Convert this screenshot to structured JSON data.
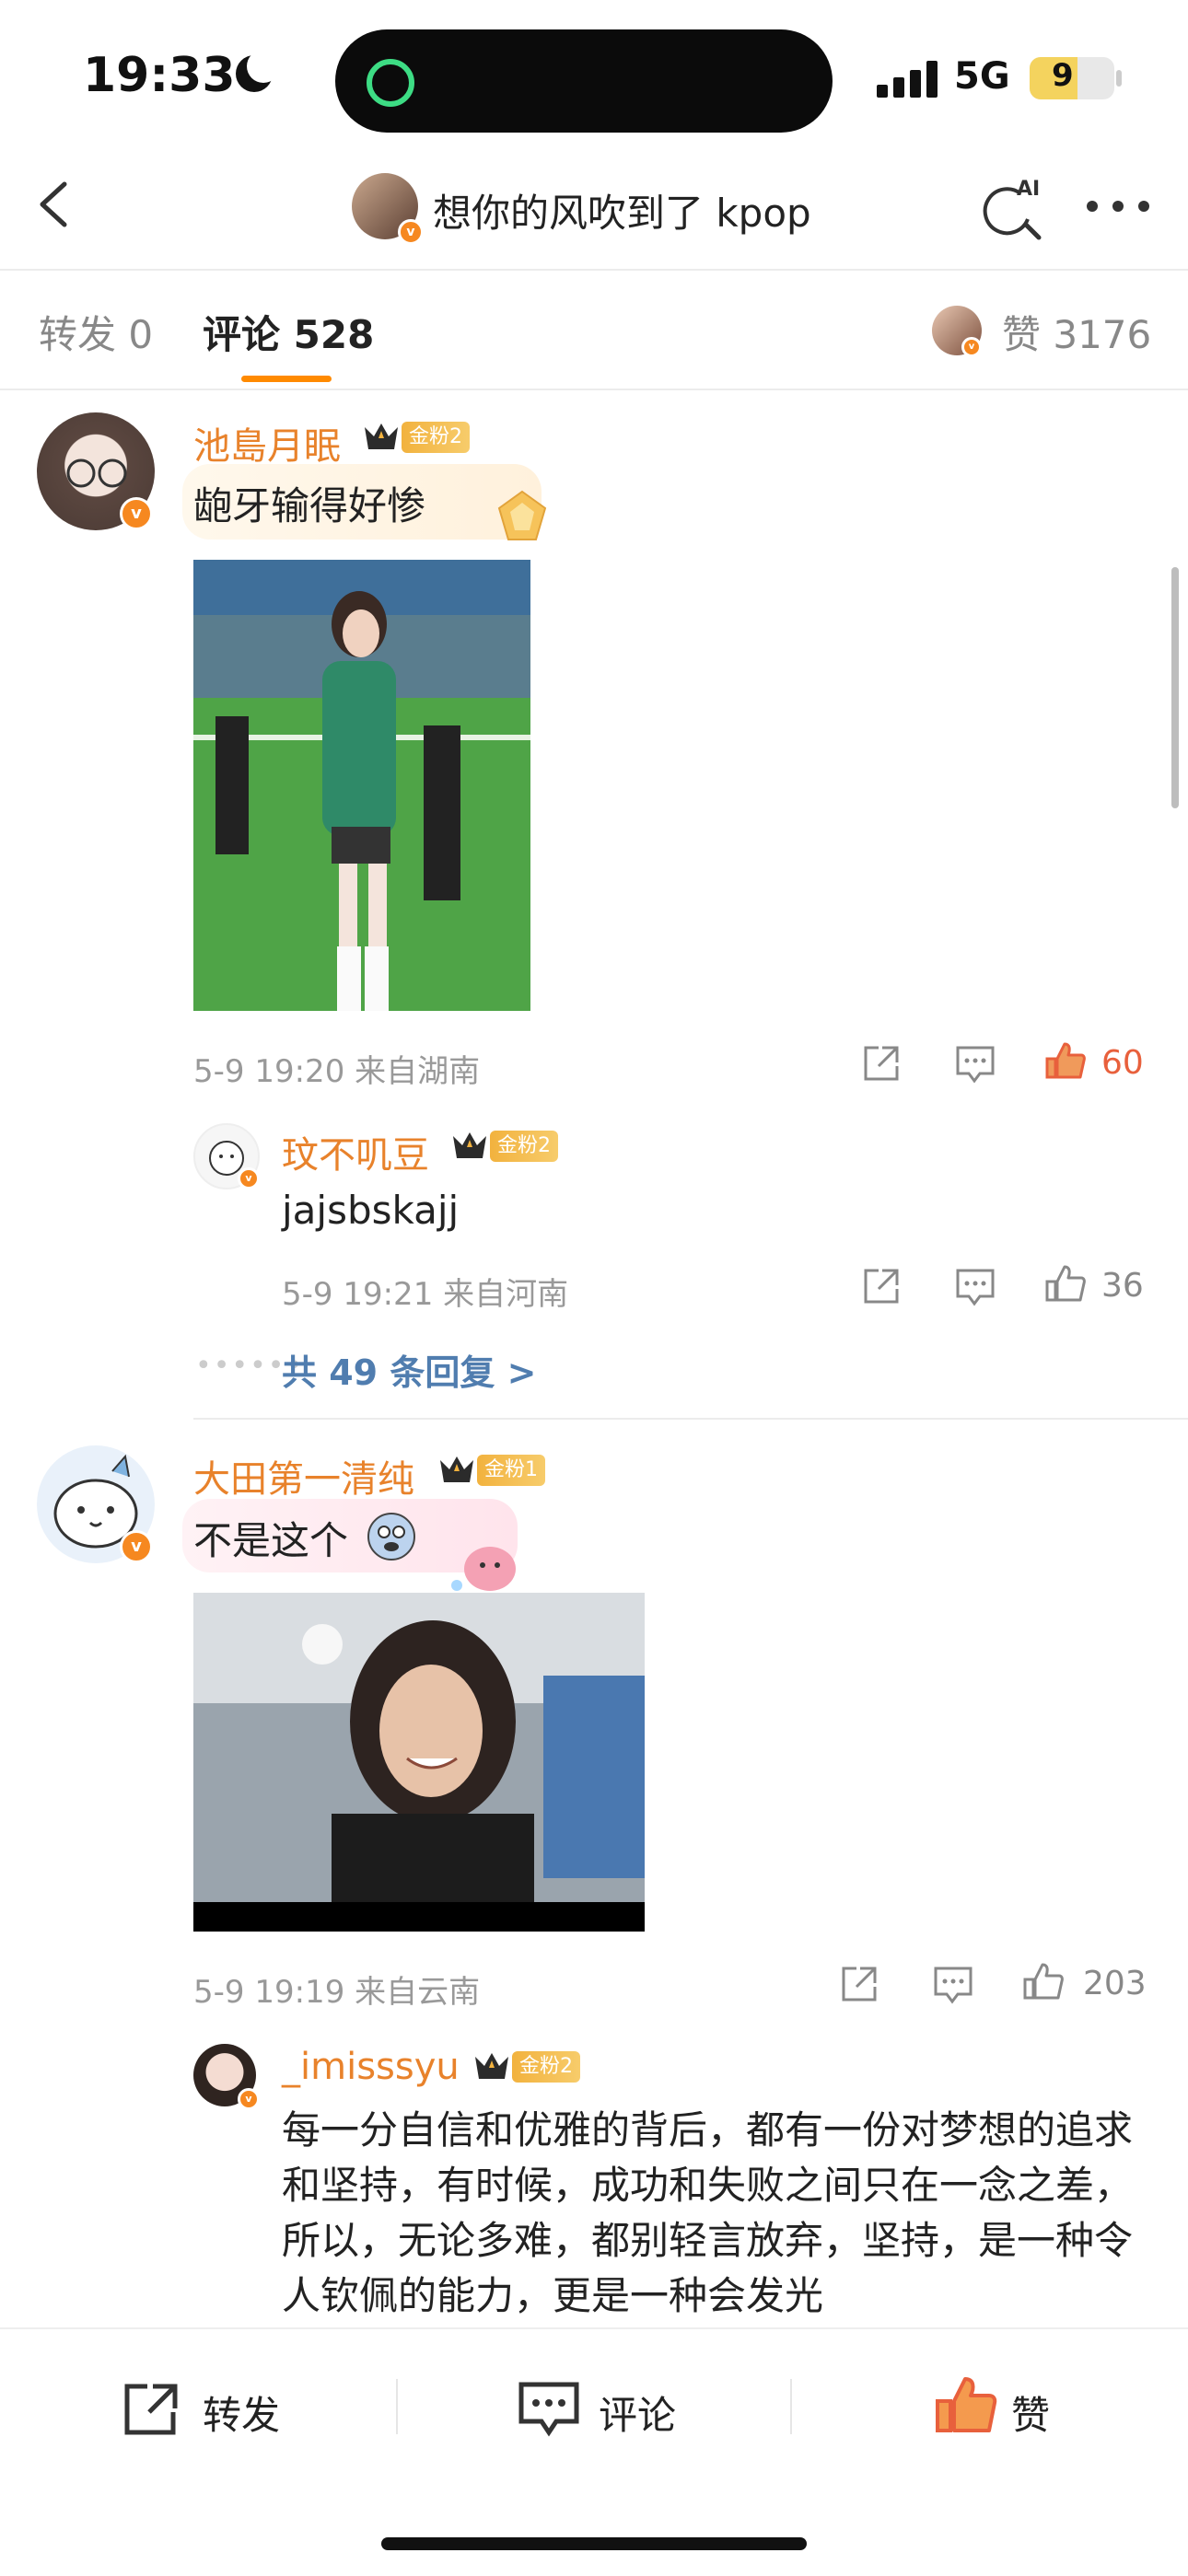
{
  "status_bar": {
    "time": "19:33",
    "network": "5G",
    "battery": "9"
  },
  "nav": {
    "title": "想你的风吹到了 kpop",
    "ai_label": "AI"
  },
  "tabs": {
    "repost": "转发 0",
    "comments": "评论 528",
    "likes": "赞 3176"
  },
  "comments": [
    {
      "username": "池島月眠",
      "fan_badge": "金粉2",
      "text": "龅牙输得好惨",
      "meta": "5-9 19:20  来自湖南",
      "likes": "60",
      "liked": true,
      "replies": [
        {
          "username": "玟不叽豆",
          "fan_badge": "金粉2",
          "text": "jajsbskajj",
          "meta": "5-9 19:21  来自河南",
          "likes": "36"
        }
      ],
      "more_replies": "共 49 条回复 >"
    },
    {
      "username": "大田第一清纯",
      "fan_badge": "金粉1",
      "text": "不是这个",
      "meta": "5-9 19:19  来自云南",
      "likes": "203",
      "replies": [
        {
          "username": "_imisssyu",
          "fan_badge": "金粉2",
          "text": "每一分自信和优雅的背后，都有一份对梦想的追求和坚持，有时候，成功和失败之间只在一念之差，所以，无论多难，都别轻言放弃，坚持，是一种令人钦佩的能力，更是一种会发光"
        }
      ]
    }
  ],
  "bottom_bar": {
    "repost": "转发",
    "comment": "评论",
    "like": "赞"
  },
  "colors": {
    "accent": "#ff8a00",
    "username": "#e8822b",
    "link": "#507daf",
    "liked": "#e8603c"
  }
}
